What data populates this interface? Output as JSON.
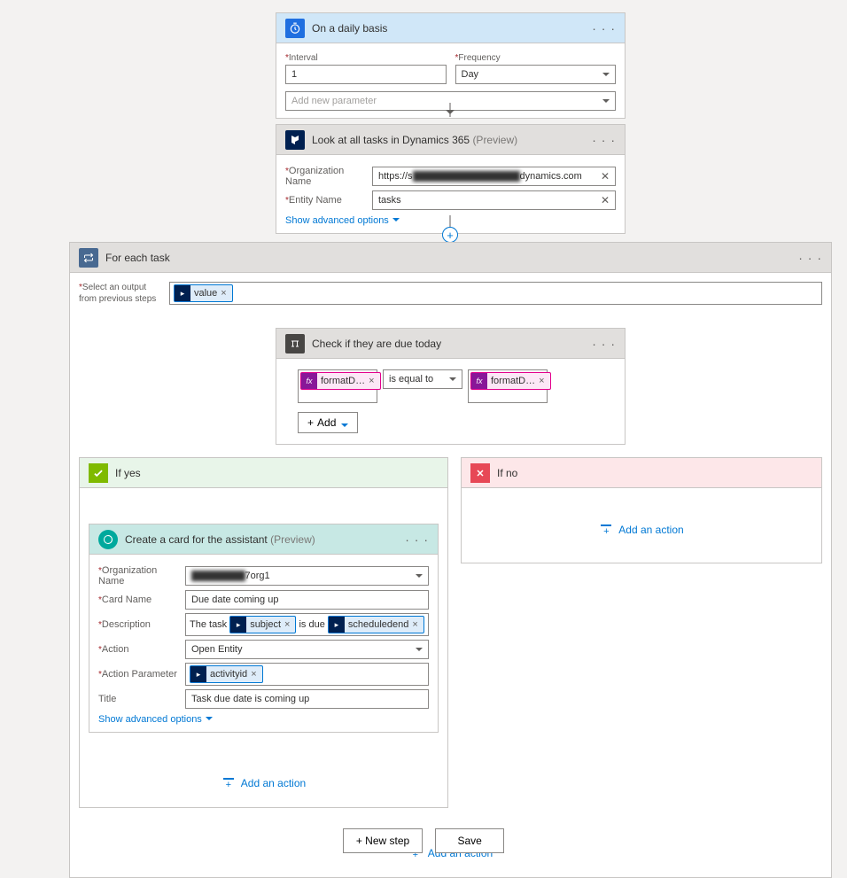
{
  "trigger": {
    "title": "On a daily basis",
    "interval_label": "Interval",
    "interval_value": "1",
    "frequency_label": "Frequency",
    "frequency_value": "Day",
    "add_param_placeholder": "Add new parameter"
  },
  "lookup": {
    "title": "Look at all tasks in Dynamics 365",
    "preview": "(Preview)",
    "org_label": "Organization Name",
    "org_value_prefix": "https://s",
    "org_value_suffix": "dynamics.com",
    "entity_label": "Entity Name",
    "entity_value": "tasks",
    "advanced": "Show advanced options"
  },
  "foreach": {
    "title": "For each task",
    "select_label_1": "Select an output",
    "select_label_2": "from previous steps",
    "token": "value"
  },
  "condition": {
    "title": "Check if they are due today",
    "fx1": "formatD…",
    "operator": "is equal to",
    "fx2": "formatD…",
    "add": "Add"
  },
  "ifyes": {
    "label": "If yes"
  },
  "ifno": {
    "label": "If no"
  },
  "createcard": {
    "title": "Create a card for the assistant",
    "preview": "(Preview)",
    "org_label": "Organization Name",
    "org_value_suffix": "7org1",
    "cardname_label": "Card Name",
    "cardname_value": "Due date coming up",
    "desc_label": "Description",
    "desc_prefix": "The task",
    "desc_token1": "subject",
    "desc_mid": "is due",
    "desc_token2": "scheduledend",
    "action_label": "Action",
    "action_value": "Open Entity",
    "actionparam_label": "Action Parameter",
    "actionparam_token": "activityid",
    "title_label": "Title",
    "title_value": "Task due date is coming up",
    "advanced": "Show advanced options"
  },
  "add_action": "Add an action",
  "footer": {
    "new_step": "+ New step",
    "save": "Save"
  }
}
